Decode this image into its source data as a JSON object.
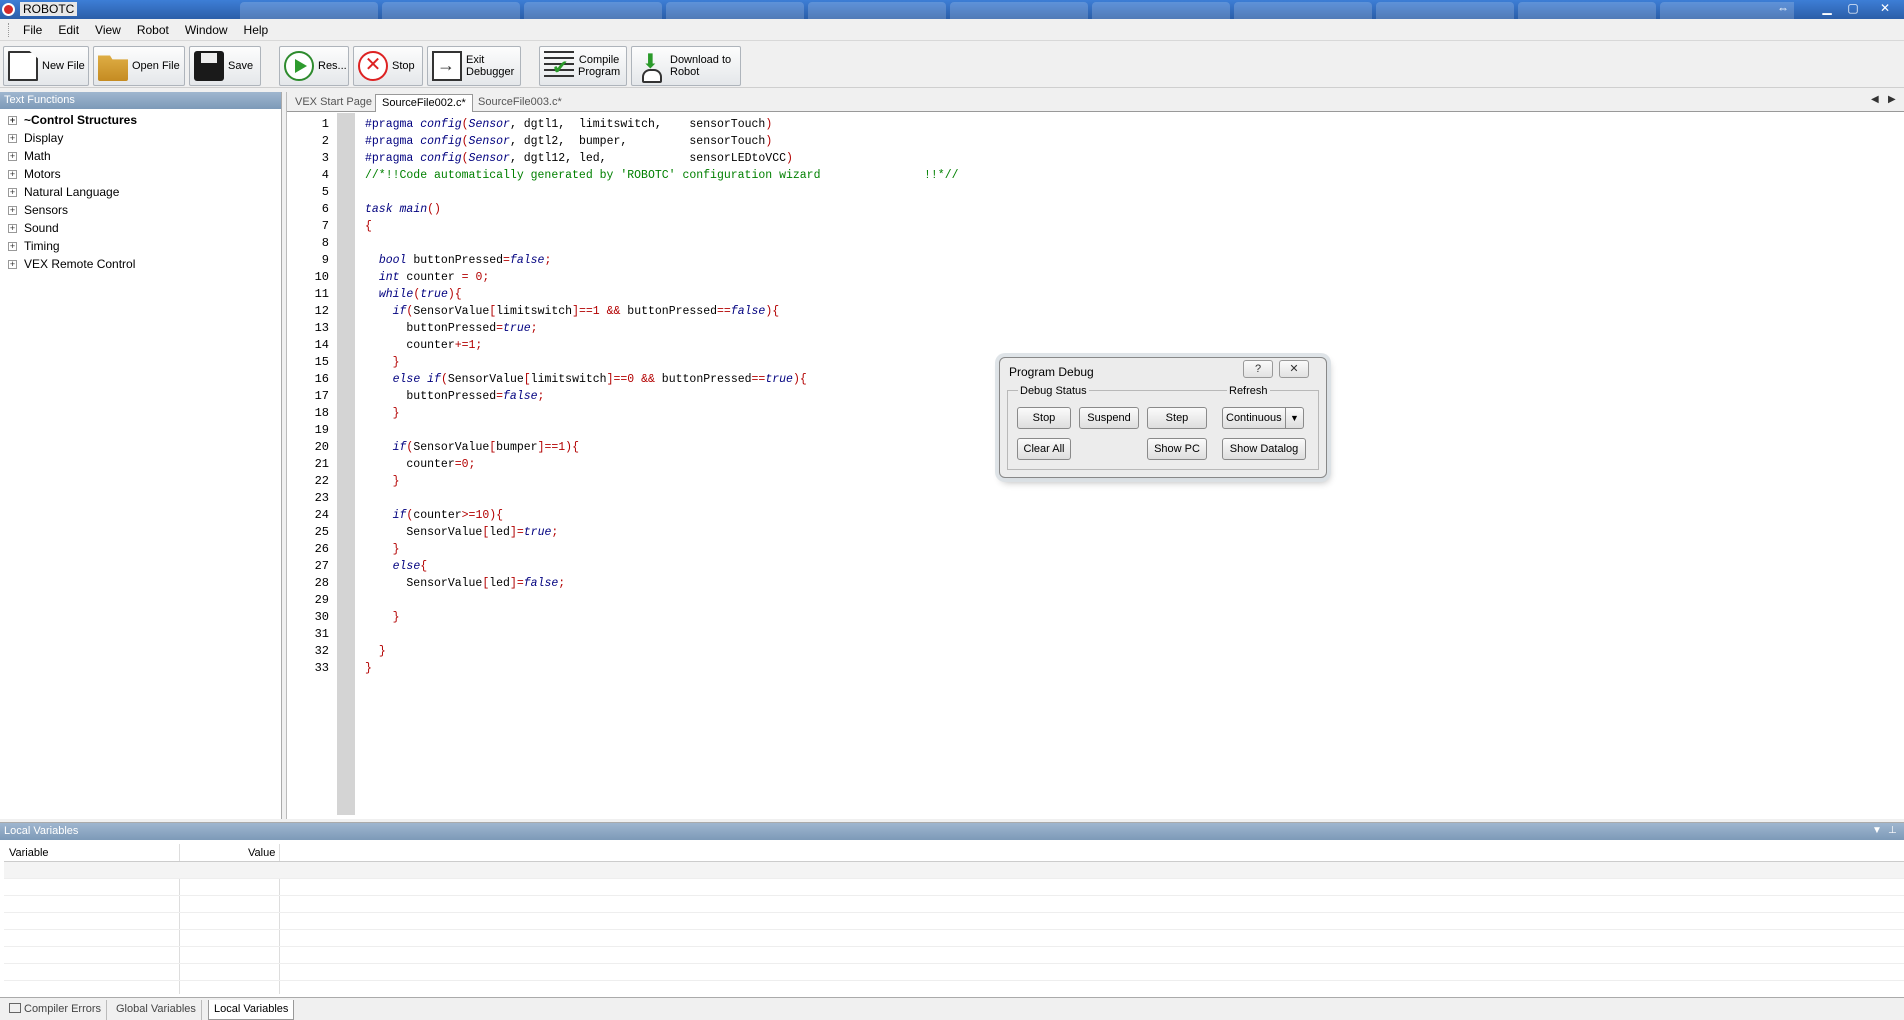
{
  "window": {
    "title": "ROBOTC"
  },
  "menu": [
    "File",
    "Edit",
    "View",
    "Robot",
    "Window",
    "Help"
  ],
  "toolbar": {
    "new_file": "New File",
    "open_file": "Open File",
    "save": "Save",
    "resume": "Res...",
    "stop": "Stop",
    "exit_debugger_1": "Exit",
    "exit_debugger_2": "Debugger",
    "compile_1": "Compile",
    "compile_2": "Program",
    "download_1": "Download to",
    "download_2": "Robot"
  },
  "text_functions": {
    "header": "Text Functions",
    "items": [
      "~Control Structures",
      "Display",
      "Math",
      "Motors",
      "Natural Language",
      "Sensors",
      "Sound",
      "Timing",
      "VEX Remote Control"
    ]
  },
  "editor": {
    "tabs": [
      "VEX Start Page",
      "SourceFile002.c*",
      "SourceFile003.c*"
    ],
    "active_tab": 1,
    "line_numbers": [
      "1",
      "2",
      "3",
      "4",
      "5",
      "6",
      "7",
      "8",
      "9",
      "10",
      "11",
      "12",
      "13",
      "14",
      "15",
      "16",
      "17",
      "18",
      "19",
      "20",
      "21",
      "22",
      "23",
      "24",
      "25",
      "26",
      "27",
      "28",
      "29",
      "30",
      "31",
      "32",
      "33"
    ]
  },
  "debug_dialog": {
    "title": "Program Debug",
    "help_glyph": "?",
    "close_glyph": "✕",
    "debug_status_label": "Debug Status",
    "refresh_label": "Refresh",
    "stop": "Stop",
    "suspend": "Suspend",
    "step": "Step",
    "refresh_value": "Continuous",
    "clear_all": "Clear All",
    "show_pc": "Show PC",
    "show_datalog": "Show Datalog"
  },
  "local_variables": {
    "header": "Local Variables",
    "columns": [
      "Variable",
      "Value"
    ]
  },
  "bottom_tabs": [
    "Compiler Errors",
    "Global Variables",
    "Local Variables"
  ]
}
